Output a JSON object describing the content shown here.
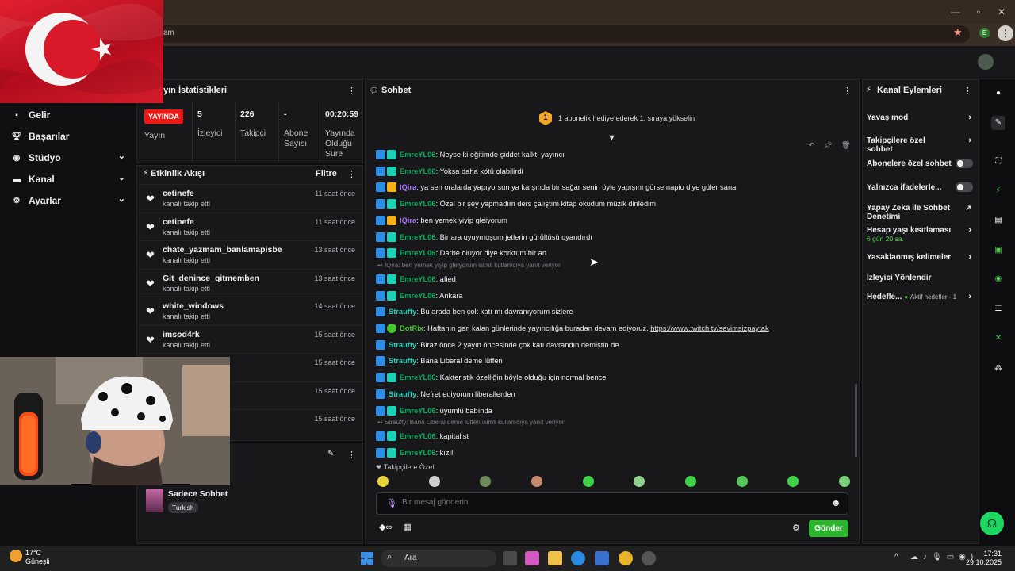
{
  "browser": {
    "address_fragment": "am",
    "star_icon": "star-icon",
    "profile_letter": "E"
  },
  "stats": {
    "title": "yın İstatistikleri",
    "live_badge": "YAYINDA",
    "cols": [
      {
        "value": "",
        "label": "Yayın"
      },
      {
        "value": "5",
        "label": "İzleyici"
      },
      {
        "value": "226",
        "label": "Takipçi"
      },
      {
        "value": "-",
        "label": "Abone Sayısı"
      },
      {
        "value": "00:20:59",
        "label": "Yayında Olduğu Süre"
      }
    ]
  },
  "nav": [
    {
      "label": "Gelir",
      "icon": "dollar-icon",
      "chevron": false
    },
    {
      "label": "Başarılar",
      "icon": "trophy-icon",
      "chevron": false
    },
    {
      "label": "Stüdyo",
      "icon": "studio-icon",
      "chevron": true
    },
    {
      "label": "Kanal",
      "icon": "channel-icon",
      "chevron": true
    },
    {
      "label": "Ayarlar",
      "icon": "gear-icon",
      "chevron": true
    }
  ],
  "activity": {
    "title": "Etkinlik Akışı",
    "filter": "Filtre",
    "items": [
      {
        "user": "cetinefe",
        "sub": "kanalı takip etti",
        "time": "11 saat önce"
      },
      {
        "user": "cetinefe",
        "sub": "kanalı takip etti",
        "time": "11 saat önce"
      },
      {
        "user": "chate_yazmam_banlamapisbe",
        "sub": "kanalı takip etti",
        "time": "13 saat önce"
      },
      {
        "user": "Git_denince_gitmemben",
        "sub": "kanalı takip etti",
        "time": "13 saat önce"
      },
      {
        "user": "white_windows",
        "sub": "kanalı takip etti",
        "time": "14 saat önce"
      },
      {
        "user": "imsod4rk",
        "sub": "kanalı takip etti",
        "time": "15 saat önce"
      },
      {
        "user": "",
        "sub": "",
        "time": "15 saat önce"
      },
      {
        "user": "",
        "sub": "",
        "time": "15 saat önce"
      },
      {
        "user": "",
        "sub": "",
        "time": "15 saat önce"
      }
    ]
  },
  "panel2": {
    "title": "Sadece Sohbet",
    "tag": "Turkish"
  },
  "chat": {
    "title": "Sohbet",
    "hype": {
      "level": "1",
      "text": "1 abonelik hediye ederek 1. sıraya yükselin"
    },
    "messages": [
      {
        "user": "EmreYL06",
        "color": "#00ad5c",
        "badges": [
          "b",
          "g"
        ],
        "text": ": Neyse ki eğitimde şiddet kalktı yayıncı"
      },
      {
        "user": "EmreYL06",
        "color": "#00ad5c",
        "badges": [
          "b",
          "g"
        ],
        "text": ": Yoksa daha kötü olabilirdi"
      },
      {
        "user": "IQira",
        "color": "#a970ff",
        "badges": [
          "b",
          "y"
        ],
        "text": ": ya sen oralarda yapıyorsun ya karşında bir sağar senin öyle yapışını görse napio diye güler sana"
      },
      {
        "user": "EmreYL06",
        "color": "#00ad5c",
        "badges": [
          "b",
          "g"
        ],
        "text": ": Özel bir şey yapmadım ders çalıştım kitap okudum müzik dinledim"
      },
      {
        "user": "IQira",
        "color": "#a970ff",
        "badges": [
          "b",
          "y"
        ],
        "text": ": ben yemek yiyip gleiyorum"
      },
      {
        "user": "EmreYL06",
        "color": "#00ad5c",
        "badges": [
          "b",
          "g"
        ],
        "text": ": Bir ara uyuymuşum jetlerin gürültüsü uyandırdı"
      },
      {
        "user": "EmreYL06",
        "color": "#00ad5c",
        "badges": [
          "b",
          "g"
        ],
        "text": ": Darbe oluyor diye korktum bir an"
      },
      {
        "reply": "IQira: ben yemek yiyip gleiyorum isimli kullanıcıya yanıt veriyor"
      },
      {
        "user": "EmreYL06",
        "color": "#00ad5c",
        "badges": [
          "b",
          "g"
        ],
        "text": ": afied"
      },
      {
        "user": "EmreYL06",
        "color": "#00ad5c",
        "badges": [
          "b",
          "g"
        ],
        "text": ": Ankara"
      },
      {
        "user": "Strauffy",
        "color": "#1ed0b5",
        "badges": [
          "b"
        ],
        "text": ": Bu arada ben çok katı mı davranıyorum sizlere"
      },
      {
        "user": "BotRix",
        "color": "#48c72f",
        "badges": [
          "b",
          "ok"
        ],
        "text": ": Haftanın geri kalan günlerinde yayıncılığa buradan devam ediyoruz. ",
        "link": "https://www.twitch.tv/sevimsizpaytak"
      },
      {
        "user": "Strauffy",
        "color": "#1ed0b5",
        "badges": [
          "b"
        ],
        "text": ": Biraz önce 2 yayın öncesinde çok katı davrandın demiştin de"
      },
      {
        "user": "Strauffy",
        "color": "#1ed0b5",
        "badges": [
          "b"
        ],
        "text": ": Bana Liberal deme lütfen"
      },
      {
        "user": "EmreYL06",
        "color": "#00ad5c",
        "badges": [
          "b",
          "g"
        ],
        "text": ": Kakteristik özelliğin böyle olduğu için normal bence"
      },
      {
        "user": "Strauffy",
        "color": "#1ed0b5",
        "badges": [
          "b"
        ],
        "text": ": Nefret ediyorum liberallerden"
      },
      {
        "user": "EmreYL06",
        "color": "#00ad5c",
        "badges": [
          "b",
          "g"
        ],
        "text": ": uyumlu babında"
      },
      {
        "reply": "Strauffy: Bana Liberal deme lütfen isimli kullanıcıya yanıt veriyor"
      },
      {
        "user": "EmreYL06",
        "color": "#00ad5c",
        "badges": [
          "b",
          "g"
        ],
        "text": ": kapitalist"
      },
      {
        "user": "EmreYL06",
        "color": "#00ad5c",
        "badges": [
          "b",
          "g"
        ],
        "text": ": kızıl"
      }
    ],
    "followers_label": "Takipçilere Özel",
    "input_placeholder": "Bir mesaj gönderin",
    "send_label": "Gönder",
    "emote_colors": [
      "#e5d23a",
      "#cfcfcf",
      "#6d8a5a",
      "#c48a6a",
      "#3fd04a",
      "#8fd08f",
      "#3fd04a",
      "#56c45a",
      "#3fd04a",
      "#7ad07a"
    ]
  },
  "actions": {
    "title": "Kanal Eylemleri",
    "items": [
      {
        "label": "Yavaş mod",
        "type": "chevron"
      },
      {
        "label": "Takipçilere özel sohbet",
        "type": "chevron"
      },
      {
        "label": "Abonelere özel sohbet",
        "type": "toggle"
      },
      {
        "label": "Yalnızca ifadelerle...",
        "type": "toggle"
      },
      {
        "label": "Yapay Zeka ile Sohbet Denetimi",
        "type": "external"
      },
      {
        "label": "Hesap yaşı kısıtlaması",
        "sub": "6 gün 20 sa.",
        "type": "chevron"
      },
      {
        "label": "Yasaklanmış kelimeler",
        "type": "chevron"
      },
      {
        "label": "İzleyici Yönlendir",
        "type": "none"
      },
      {
        "label": "Hedefle...",
        "sub_inline": "Aktif hedefler - 1",
        "type": "chevron"
      }
    ]
  },
  "taskbar": {
    "temp": "17°C",
    "weather": "Güneşli",
    "search": "Ara",
    "time": "17:31",
    "date": "29.10.2025"
  }
}
